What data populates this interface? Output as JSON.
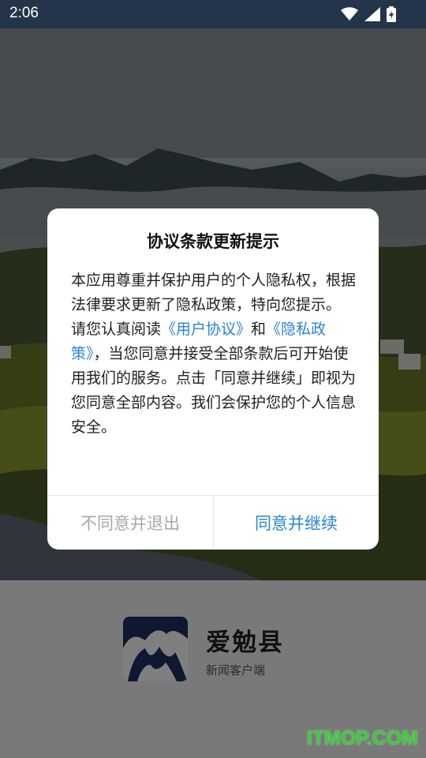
{
  "status_bar": {
    "time": "2:06",
    "icons": [
      "wifi-icon",
      "signal-icon",
      "battery-charging-icon"
    ]
  },
  "brand": {
    "name": "爱勉县",
    "subtitle": "新闻客户端"
  },
  "dialog": {
    "title": "协议条款更新提示",
    "paragraph1": "本应用尊重并保护用户的个人隐私权，根据法律要求更新了隐私政策，特向您提示。",
    "p2_prefix": "请您认真阅读",
    "user_agreement_link": "《用户协议》",
    "p2_and": "和",
    "privacy_policy_link": "《隐私政策》",
    "p2_suffix": "，当您同意并接受全部条款后可开始使用我们的服务。点击「同意并继续」即视为您同意全部内容。我们会保护您的个人信息安全。",
    "decline_label": "不同意并退出",
    "accept_label": "同意并继续"
  },
  "watermark": "ITMOP.COM",
  "colors": {
    "accent": "#2a84d8",
    "decline_text": "#a8a8a8",
    "status_bar_bg": "#24344a",
    "logo_bg": "#1f2f63",
    "watermark": "#35d035"
  }
}
